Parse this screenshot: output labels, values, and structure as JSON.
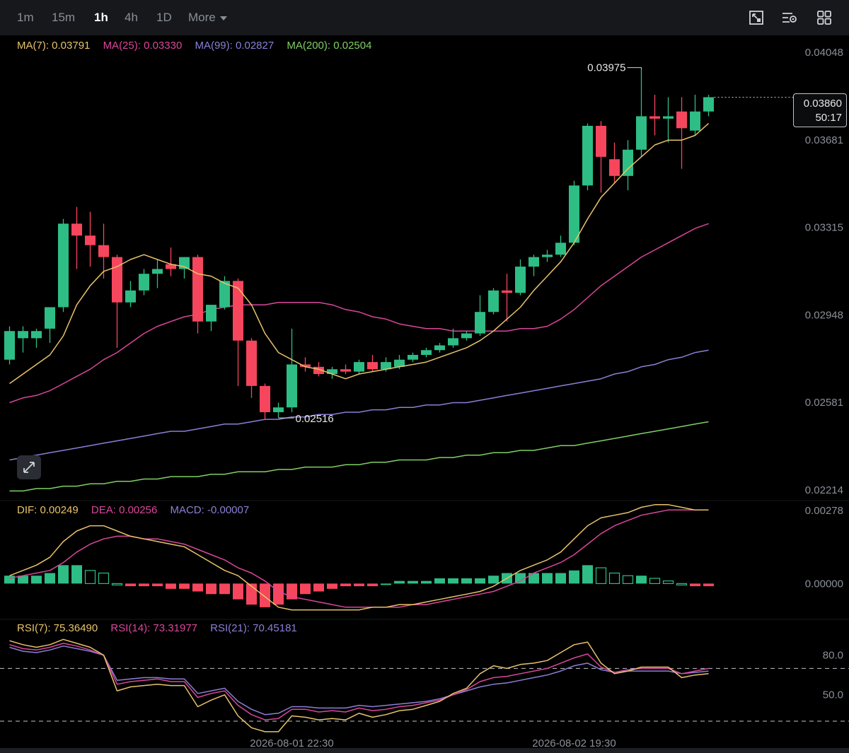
{
  "toolbar": {
    "intervals": [
      {
        "label": "1m",
        "active": false
      },
      {
        "label": "15m",
        "active": false
      },
      {
        "label": "1h",
        "active": true
      },
      {
        "label": "4h",
        "active": false
      },
      {
        "label": "1D",
        "active": false
      }
    ],
    "more_label": "More",
    "icons": [
      "fullscreen-icon",
      "indicator-settings-icon",
      "layout-grid-icon"
    ]
  },
  "legend": {
    "ma": [
      {
        "text": "MA(7): 0.03791",
        "color": "#e8c36a"
      },
      {
        "text": "MA(25): 0.03330",
        "color": "#d9479b"
      },
      {
        "text": "MA(99): 0.02827",
        "color": "#8b7fd6"
      },
      {
        "text": "MA(200): 0.02504",
        "color": "#7fcf64"
      }
    ],
    "macd": [
      {
        "text": "DIF: 0.00249",
        "color": "#e8c36a"
      },
      {
        "text": "DEA: 0.00256",
        "color": "#d9479b"
      },
      {
        "text": "MACD: -0.00007",
        "color": "#8b7fd6"
      }
    ],
    "rsi": [
      {
        "text": "RSI(7): 75.36490",
        "color": "#e8c36a"
      },
      {
        "text": "RSI(14): 73.31977",
        "color": "#d9479b"
      },
      {
        "text": "RSI(21): 70.45181",
        "color": "#8b7fd6"
      }
    ]
  },
  "current_price": {
    "value": "0.03860",
    "countdown": "50:17"
  },
  "colors": {
    "up": "#2ebd85",
    "down": "#f6465d",
    "ma7": "#e8c36a",
    "ma25": "#d9479b",
    "ma99": "#8b7fd6",
    "ma200": "#7fcf64"
  },
  "chart_data": {
    "type": "candlestick",
    "interval": "1h",
    "price_axis": {
      "ticks": [
        "0.04048",
        "0.03681",
        "0.03315",
        "0.02948",
        "0.02581",
        "0.02214"
      ],
      "range": [
        0.02214,
        0.04048
      ]
    },
    "time_labels": [
      {
        "index": 21,
        "label": "2026-08-01 22:30"
      },
      {
        "index": 42,
        "label": "2026-08-02 19:30"
      }
    ],
    "annotations": [
      {
        "text": "0.03975",
        "index": 47,
        "price": 0.03975
      },
      {
        "text": "0.02516",
        "index": 20,
        "price": 0.02516
      }
    ],
    "candles": [
      {
        "o": 0.0276,
        "h": 0.029,
        "l": 0.0274,
        "c": 0.0288
      },
      {
        "o": 0.0285,
        "h": 0.029,
        "l": 0.0279,
        "c": 0.0288
      },
      {
        "o": 0.0285,
        "h": 0.0289,
        "l": 0.0281,
        "c": 0.0288
      },
      {
        "o": 0.0289,
        "h": 0.0294,
        "l": 0.0283,
        "c": 0.0298
      },
      {
        "o": 0.0298,
        "h": 0.0335,
        "l": 0.0296,
        "c": 0.0333
      },
      {
        "o": 0.0333,
        "h": 0.034,
        "l": 0.0314,
        "c": 0.0328
      },
      {
        "o": 0.0328,
        "h": 0.0338,
        "l": 0.0315,
        "c": 0.0324
      },
      {
        "o": 0.0324,
        "h": 0.0333,
        "l": 0.031,
        "c": 0.0319
      },
      {
        "o": 0.0319,
        "h": 0.032,
        "l": 0.0281,
        "c": 0.03
      },
      {
        "o": 0.03,
        "h": 0.0309,
        "l": 0.0298,
        "c": 0.0305
      },
      {
        "o": 0.0305,
        "h": 0.0314,
        "l": 0.0303,
        "c": 0.0312
      },
      {
        "o": 0.0312,
        "h": 0.0318,
        "l": 0.0306,
        "c": 0.0314
      },
      {
        "o": 0.0316,
        "h": 0.0323,
        "l": 0.0311,
        "c": 0.0314
      },
      {
        "o": 0.0314,
        "h": 0.0319,
        "l": 0.031,
        "c": 0.0319
      },
      {
        "o": 0.0319,
        "h": 0.032,
        "l": 0.0287,
        "c": 0.0292
      },
      {
        "o": 0.0292,
        "h": 0.0299,
        "l": 0.0288,
        "c": 0.0299
      },
      {
        "o": 0.0298,
        "h": 0.0311,
        "l": 0.0297,
        "c": 0.0309
      },
      {
        "o": 0.0309,
        "h": 0.031,
        "l": 0.0265,
        "c": 0.0284
      },
      {
        "o": 0.0284,
        "h": 0.0285,
        "l": 0.026,
        "c": 0.0265
      },
      {
        "o": 0.0265,
        "h": 0.0266,
        "l": 0.0251,
        "c": 0.0254
      },
      {
        "o": 0.0254,
        "h": 0.0258,
        "l": 0.02516,
        "c": 0.0256
      },
      {
        "o": 0.0256,
        "h": 0.0289,
        "l": 0.0254,
        "c": 0.0274
      },
      {
        "o": 0.0274,
        "h": 0.0277,
        "l": 0.0271,
        "c": 0.0273
      },
      {
        "o": 0.0273,
        "h": 0.0275,
        "l": 0.0269,
        "c": 0.027
      },
      {
        "o": 0.027,
        "h": 0.0273,
        "l": 0.0268,
        "c": 0.0272
      },
      {
        "o": 0.0272,
        "h": 0.0274,
        "l": 0.027,
        "c": 0.0271
      },
      {
        "o": 0.0271,
        "h": 0.0276,
        "l": 0.027,
        "c": 0.0275
      },
      {
        "o": 0.0275,
        "h": 0.0278,
        "l": 0.0271,
        "c": 0.0272
      },
      {
        "o": 0.0272,
        "h": 0.0277,
        "l": 0.0271,
        "c": 0.0275
      },
      {
        "o": 0.0273,
        "h": 0.0278,
        "l": 0.0272,
        "c": 0.0276
      },
      {
        "o": 0.0276,
        "h": 0.0279,
        "l": 0.0275,
        "c": 0.0278
      },
      {
        "o": 0.0278,
        "h": 0.0281,
        "l": 0.0277,
        "c": 0.028
      },
      {
        "o": 0.028,
        "h": 0.0283,
        "l": 0.0279,
        "c": 0.0282
      },
      {
        "o": 0.0282,
        "h": 0.0289,
        "l": 0.0281,
        "c": 0.0285
      },
      {
        "o": 0.0285,
        "h": 0.0288,
        "l": 0.0284,
        "c": 0.0287
      },
      {
        "o": 0.0287,
        "h": 0.0303,
        "l": 0.0286,
        "c": 0.0296
      },
      {
        "o": 0.0296,
        "h": 0.0306,
        "l": 0.0295,
        "c": 0.0305
      },
      {
        "o": 0.0305,
        "h": 0.0312,
        "l": 0.0292,
        "c": 0.0304
      },
      {
        "o": 0.0304,
        "h": 0.0318,
        "l": 0.0303,
        "c": 0.0315
      },
      {
        "o": 0.0315,
        "h": 0.032,
        "l": 0.0311,
        "c": 0.0319
      },
      {
        "o": 0.0319,
        "h": 0.0322,
        "l": 0.0317,
        "c": 0.032
      },
      {
        "o": 0.032,
        "h": 0.0328,
        "l": 0.0319,
        "c": 0.0325
      },
      {
        "o": 0.0325,
        "h": 0.0351,
        "l": 0.0324,
        "c": 0.0349
      },
      {
        "o": 0.0349,
        "h": 0.0375,
        "l": 0.0347,
        "c": 0.0374
      },
      {
        "o": 0.0374,
        "h": 0.0376,
        "l": 0.0346,
        "c": 0.0361
      },
      {
        "o": 0.036,
        "h": 0.0367,
        "l": 0.035,
        "c": 0.0353
      },
      {
        "o": 0.0353,
        "h": 0.0368,
        "l": 0.0347,
        "c": 0.0364
      },
      {
        "o": 0.0364,
        "h": 0.03975,
        "l": 0.0361,
        "c": 0.0378
      },
      {
        "o": 0.0378,
        "h": 0.0387,
        "l": 0.037,
        "c": 0.0377
      },
      {
        "o": 0.0377,
        "h": 0.0386,
        "l": 0.0367,
        "c": 0.0378
      },
      {
        "o": 0.038,
        "h": 0.0386,
        "l": 0.0356,
        "c": 0.0373
      },
      {
        "o": 0.0372,
        "h": 0.0387,
        "l": 0.037,
        "c": 0.038
      },
      {
        "o": 0.038,
        "h": 0.0387,
        "l": 0.0378,
        "c": 0.0386
      }
    ],
    "ma7": [
      0.0266,
      0.027,
      0.0274,
      0.0278,
      0.0286,
      0.0299,
      0.0307,
      0.0313,
      0.0315,
      0.0318,
      0.032,
      0.0318,
      0.0316,
      0.0315,
      0.0312,
      0.0311,
      0.0308,
      0.0306,
      0.0299,
      0.0287,
      0.0279,
      0.0276,
      0.0273,
      0.0272,
      0.027,
      0.0268,
      0.027,
      0.0271,
      0.0272,
      0.0273,
      0.0274,
      0.0275,
      0.0277,
      0.0279,
      0.0281,
      0.0284,
      0.0288,
      0.0293,
      0.0298,
      0.0305,
      0.0311,
      0.0317,
      0.0325,
      0.0335,
      0.0344,
      0.035,
      0.0356,
      0.0361,
      0.0366,
      0.0368,
      0.0368,
      0.037,
      0.0375
    ],
    "ma25": [
      0.0258,
      0.026,
      0.0261,
      0.0263,
      0.0266,
      0.0269,
      0.0272,
      0.0276,
      0.0279,
      0.0283,
      0.0287,
      0.029,
      0.0292,
      0.0294,
      0.0295,
      0.0297,
      0.0298,
      0.0299,
      0.0299,
      0.0299,
      0.03,
      0.03,
      0.03,
      0.03,
      0.0299,
      0.0297,
      0.0296,
      0.0294,
      0.0293,
      0.0291,
      0.029,
      0.0289,
      0.0289,
      0.0288,
      0.0288,
      0.0288,
      0.0288,
      0.0288,
      0.0289,
      0.0289,
      0.029,
      0.0293,
      0.0297,
      0.0302,
      0.0307,
      0.0311,
      0.0315,
      0.0319,
      0.0322,
      0.0325,
      0.0328,
      0.0331,
      0.0333
    ],
    "ma99": [
      0.0234,
      0.0235,
      0.0236,
      0.0237,
      0.0238,
      0.0239,
      0.024,
      0.0241,
      0.0242,
      0.0243,
      0.0244,
      0.0245,
      0.0246,
      0.0246,
      0.0247,
      0.0248,
      0.0249,
      0.0249,
      0.025,
      0.0251,
      0.0251,
      0.0252,
      0.0252,
      0.0253,
      0.0253,
      0.0254,
      0.0254,
      0.0255,
      0.0255,
      0.0256,
      0.0256,
      0.0257,
      0.0257,
      0.0258,
      0.0258,
      0.0259,
      0.026,
      0.0261,
      0.0262,
      0.0263,
      0.0264,
      0.0265,
      0.0266,
      0.0267,
      0.0268,
      0.027,
      0.0271,
      0.0273,
      0.0274,
      0.0276,
      0.0277,
      0.0279,
      0.028
    ],
    "ma200": [
      0.0221,
      0.0221,
      0.0222,
      0.0222,
      0.0223,
      0.0223,
      0.0224,
      0.0224,
      0.0225,
      0.0225,
      0.0226,
      0.0226,
      0.0227,
      0.0227,
      0.0227,
      0.0228,
      0.0228,
      0.0229,
      0.0229,
      0.0229,
      0.023,
      0.023,
      0.0231,
      0.0231,
      0.0231,
      0.0232,
      0.0232,
      0.0233,
      0.0233,
      0.0234,
      0.0234,
      0.0234,
      0.0235,
      0.0235,
      0.0236,
      0.0236,
      0.0237,
      0.0237,
      0.0238,
      0.0238,
      0.0239,
      0.024,
      0.024,
      0.0241,
      0.0242,
      0.0243,
      0.0244,
      0.0245,
      0.0246,
      0.0247,
      0.0248,
      0.0249,
      0.025
    ],
    "macd_axis": {
      "ticks": [
        "0.00278",
        "0.00000"
      ],
      "range": [
        -0.0012,
        0.00278
      ]
    },
    "dif": [
      0.0003,
      0.0005,
      0.0007,
      0.001,
      0.0016,
      0.002,
      0.0022,
      0.0022,
      0.002,
      0.0018,
      0.0017,
      0.0016,
      0.0015,
      0.0014,
      0.0011,
      0.0008,
      0.0005,
      0.0003,
      -0.0001,
      -0.0005,
      -0.0009,
      -0.001,
      -0.001,
      -0.001,
      -0.001,
      -0.001,
      -0.001,
      -0.0009,
      -0.0009,
      -0.0008,
      -0.0008,
      -0.0007,
      -0.0006,
      -0.0005,
      -0.0004,
      -0.0003,
      -0.0001,
      0.0002,
      0.0005,
      0.0007,
      0.0009,
      0.0012,
      0.0017,
      0.0022,
      0.0025,
      0.0026,
      0.0027,
      0.0029,
      0.003,
      0.003,
      0.0029,
      0.0028,
      0.0028
    ],
    "dea": [
      0.0002,
      0.0003,
      0.0004,
      0.0005,
      0.0008,
      0.0012,
      0.0015,
      0.0017,
      0.0018,
      0.0018,
      0.0017,
      0.0017,
      0.0016,
      0.0015,
      0.0013,
      0.0011,
      0.0009,
      0.0006,
      0.0004,
      0.0001,
      -0.0003,
      -0.0005,
      -0.0006,
      -0.0007,
      -0.0008,
      -0.0009,
      -0.0009,
      -0.0009,
      -0.0009,
      -0.0009,
      -0.0008,
      -0.0008,
      -0.0007,
      -0.0006,
      -0.0005,
      -0.0004,
      -0.0003,
      -0.0001,
      0.0001,
      0.0004,
      0.0006,
      0.0008,
      0.0011,
      0.0015,
      0.0019,
      0.0022,
      0.0024,
      0.0026,
      0.0027,
      0.0028,
      0.0028,
      0.0028,
      0.0028
    ],
    "macd_hist": [
      0.0003,
      0.0003,
      0.0003,
      0.0004,
      0.0007,
      0.0007,
      0.0005,
      0.0004,
      0.0,
      -0.0001,
      -0.0001,
      -0.0001,
      -0.0002,
      -0.0002,
      -0.0003,
      -0.0004,
      -0.0004,
      -0.0006,
      -0.0008,
      -0.0009,
      -0.0008,
      -0.0006,
      -0.0004,
      -0.0003,
      -0.0002,
      -0.0001,
      -0.0001,
      -0.0001,
      0.0,
      0.0001,
      0.0001,
      0.0001,
      0.0002,
      0.0002,
      0.0002,
      0.0002,
      0.0003,
      0.0004,
      0.0004,
      0.0004,
      0.0004,
      0.0004,
      0.0005,
      0.0007,
      0.0006,
      0.0004,
      0.0003,
      0.0003,
      0.0002,
      0.0001,
      0.0,
      -0.0001,
      -0.0001
    ],
    "rsi_axis": {
      "ticks": [
        "80.0",
        "50.0"
      ],
      "range": [
        15,
        97
      ],
      "dashed_levels": [
        70,
        30
      ]
    },
    "rsi7": [
      91,
      88,
      86,
      88,
      92,
      89,
      86,
      80,
      53,
      56,
      57,
      58,
      57,
      57,
      41,
      46,
      50,
      34,
      25,
      22,
      22,
      34,
      33,
      31,
      32,
      31,
      36,
      33,
      35,
      38,
      39,
      42,
      45,
      51,
      55,
      66,
      72,
      70,
      73,
      74,
      76,
      82,
      88,
      90,
      74,
      66,
      68,
      71,
      71,
      71,
      63,
      65,
      66
    ],
    "rsi14": [
      88,
      85,
      84,
      86,
      89,
      87,
      84,
      80,
      58,
      60,
      61,
      62,
      60,
      60,
      48,
      51,
      53,
      42,
      35,
      31,
      32,
      39,
      39,
      37,
      38,
      37,
      40,
      38,
      39,
      41,
      42,
      44,
      46,
      50,
      54,
      60,
      63,
      64,
      66,
      68,
      70,
      74,
      78,
      81,
      71,
      67,
      69,
      70,
      70,
      70,
      66,
      68,
      70
    ],
    "rsi21": [
      86,
      83,
      82,
      84,
      87,
      85,
      83,
      80,
      61,
      62,
      63,
      63,
      62,
      62,
      51,
      53,
      55,
      45,
      39,
      35,
      36,
      41,
      41,
      40,
      40,
      40,
      42,
      41,
      42,
      43,
      44,
      45,
      47,
      50,
      53,
      56,
      58,
      59,
      61,
      63,
      65,
      68,
      72,
      74,
      69,
      67,
      68,
      68,
      68,
      68,
      66,
      67,
      68
    ]
  }
}
